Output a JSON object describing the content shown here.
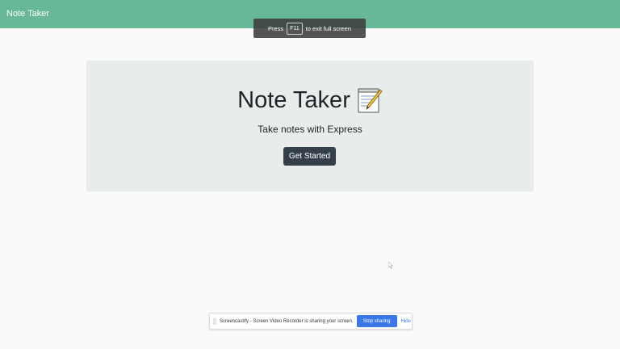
{
  "navbar": {
    "brand": "Note Taker"
  },
  "fullscreen_toast": {
    "prefix": "Press",
    "key": "F11",
    "suffix": "to exit full screen"
  },
  "hero": {
    "title": "Note Taker",
    "title_icon": "memo-icon",
    "subtitle": "Take notes with Express",
    "cta_label": "Get Started"
  },
  "share_bar": {
    "message": "Screencastify - Screen Video Recorder is sharing your screen.",
    "stop_label": "Stop sharing",
    "hide_label": "Hide"
  },
  "colors": {
    "navbar_bg": "#66b897",
    "jumbotron_bg": "#e8eceb",
    "cta_bg": "#343f4b",
    "share_accent": "#3b78e7"
  }
}
